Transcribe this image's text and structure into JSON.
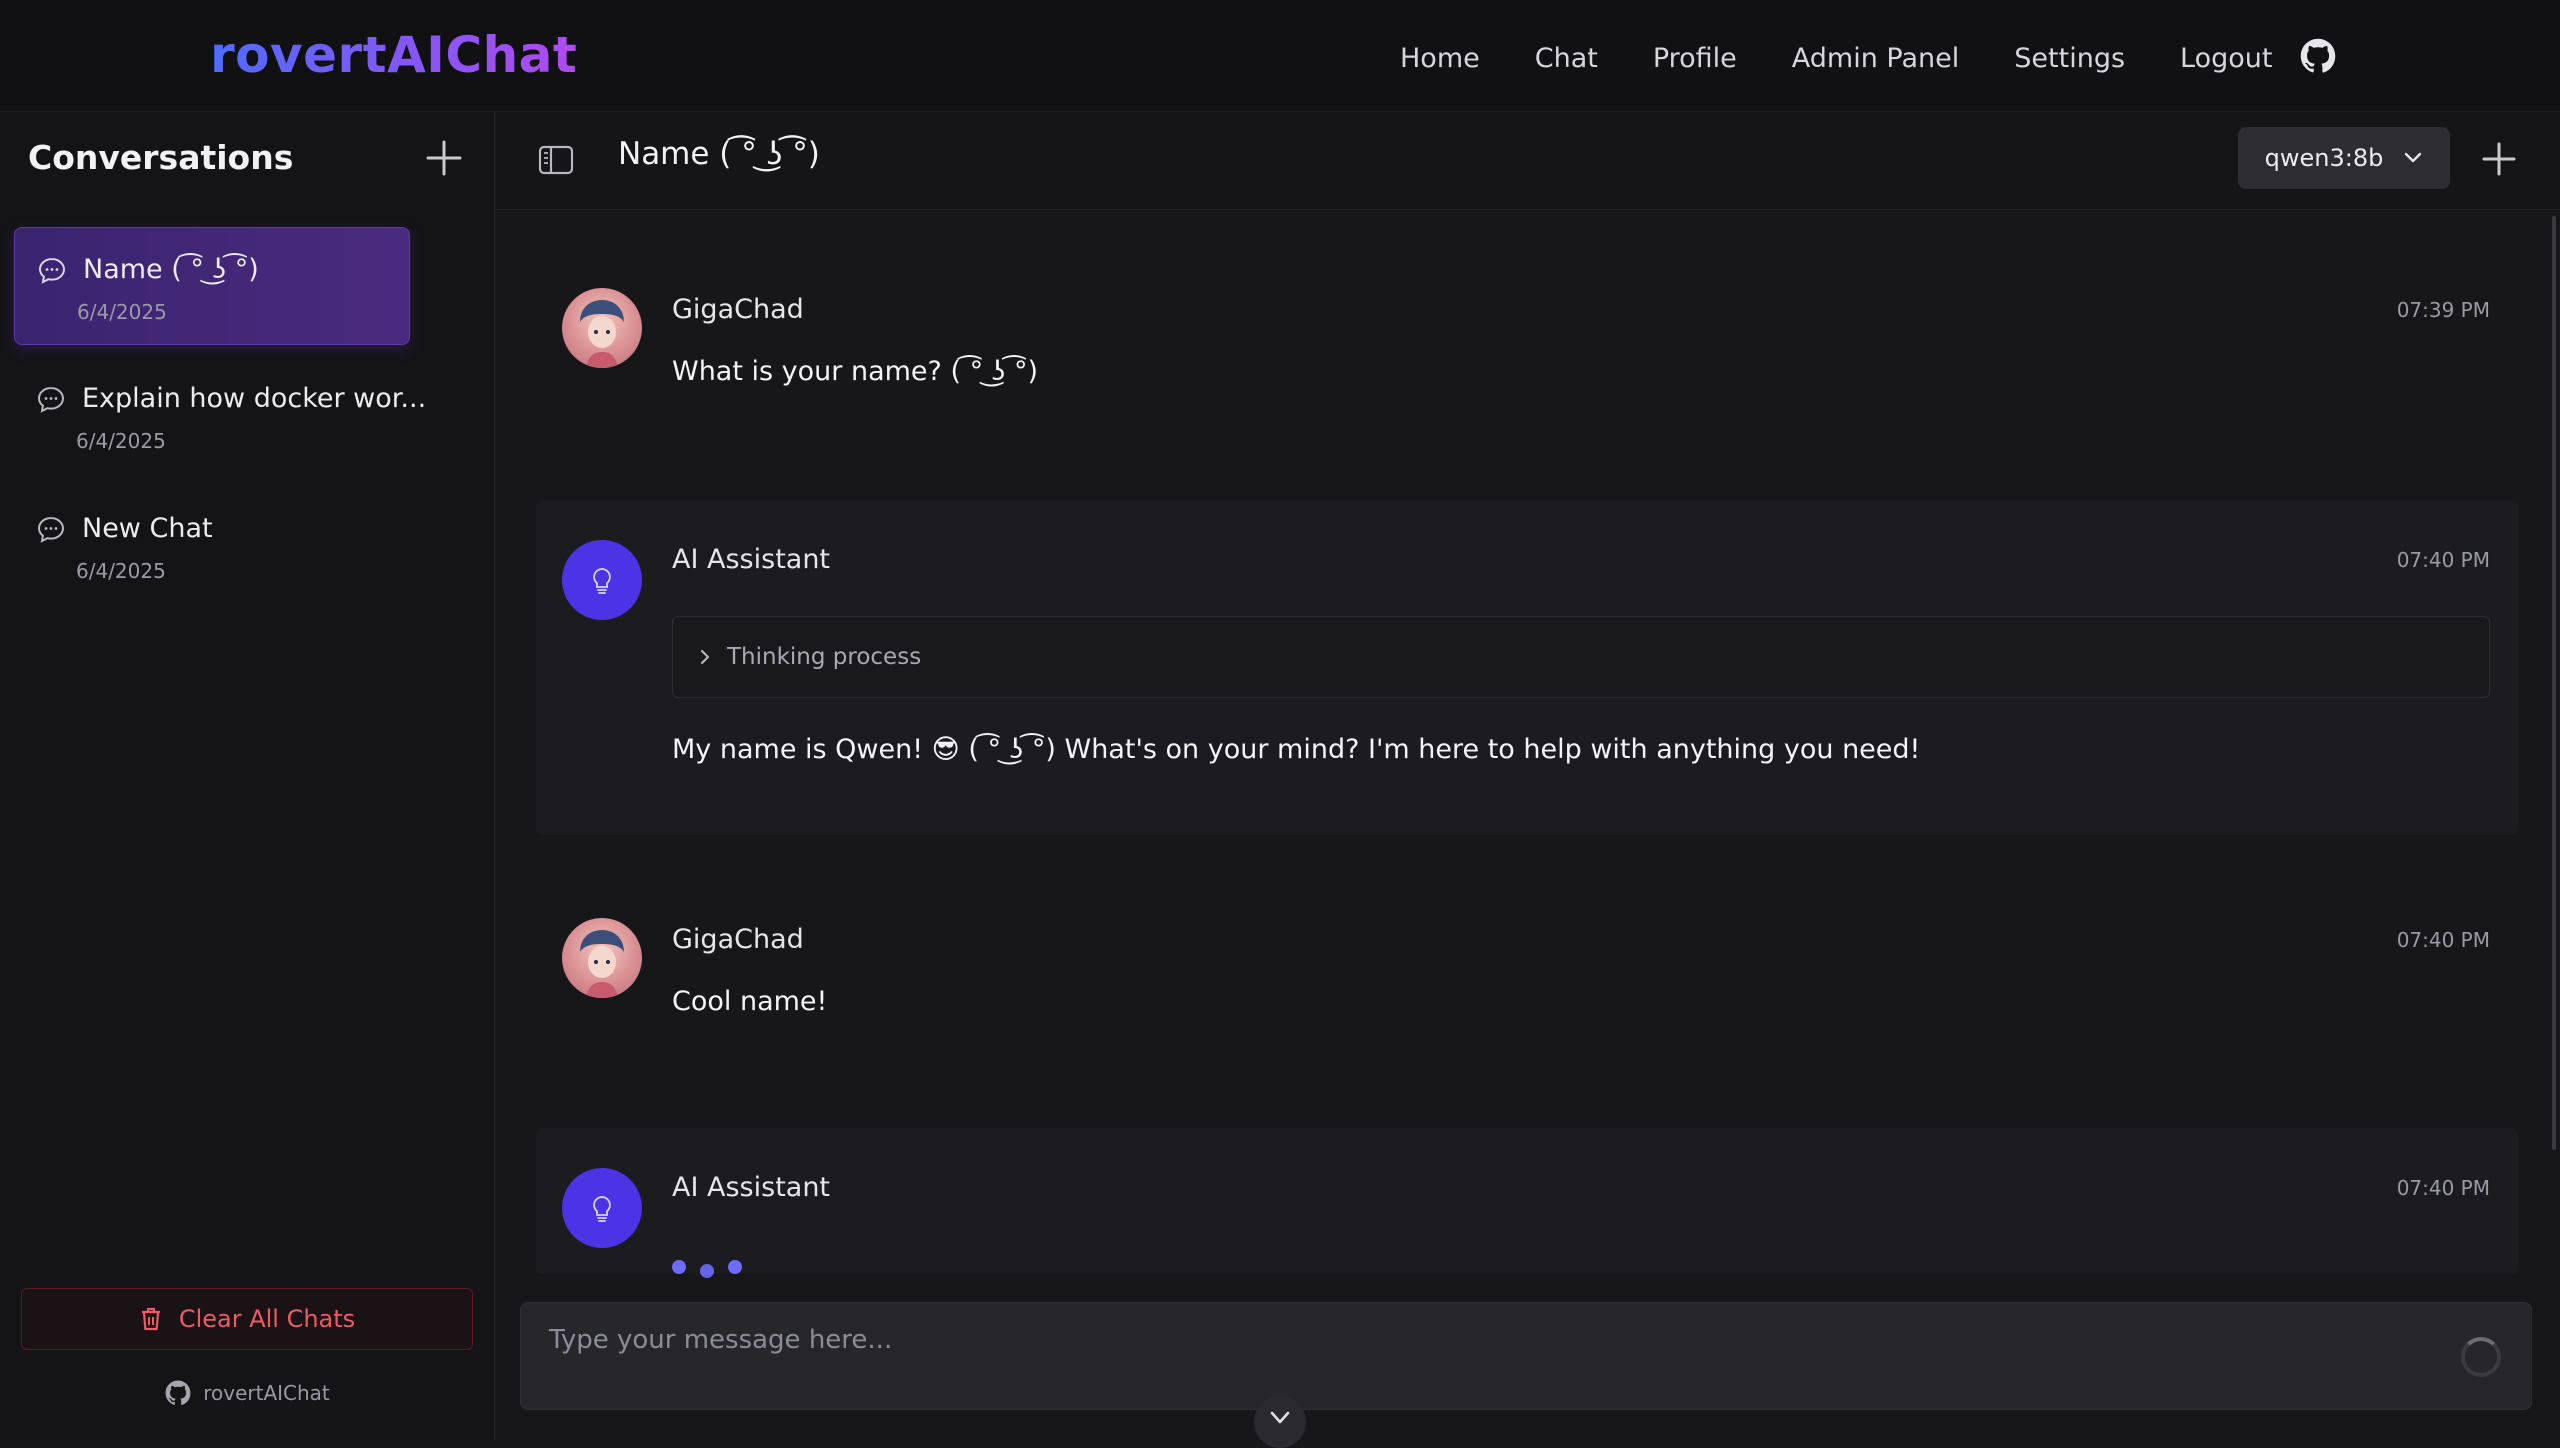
{
  "brand": "rovertAIChat",
  "nav": {
    "links": [
      "Home",
      "Chat",
      "Profile",
      "Admin Panel",
      "Settings",
      "Logout"
    ],
    "github_icon": "github-icon"
  },
  "sidebar": {
    "title": "Conversations",
    "conversations": [
      {
        "title": "Name ( ͡° ͜ʖ ͡°)",
        "date": "6/4/2025",
        "active": true
      },
      {
        "title": "Explain how docker wor...",
        "date": "6/4/2025",
        "active": false
      },
      {
        "title": "New Chat",
        "date": "6/4/2025",
        "active": false
      }
    ],
    "clear_label": "Clear All Chats",
    "footer": "rovertAIChat"
  },
  "header": {
    "chat_title": "Name ( ͡° ͜ʖ ͡°)",
    "model": "qwen3:8b"
  },
  "messages": [
    {
      "role": "user",
      "sender": "GigaChad",
      "time": "07:39 PM",
      "text": "What is your name? ( ͡° ͜ʖ ͡°)"
    },
    {
      "role": "ai",
      "sender": "AI Assistant",
      "time": "07:40 PM",
      "thinking_label": "Thinking process",
      "text": "My name is Qwen! 😎 ( ͡° ͜ʖ ͡°) What's on your mind? I'm here to help with anything you need!"
    },
    {
      "role": "user",
      "sender": "GigaChad",
      "time": "07:40 PM",
      "text": "Cool name!"
    },
    {
      "role": "ai",
      "sender": "AI Assistant",
      "time": "07:40 PM",
      "typing": true
    }
  ],
  "input": {
    "placeholder": "Type your message here..."
  },
  "colors": {
    "accent": "#4c33e6",
    "active_conv": "#3a2470",
    "danger": "#ef5a66"
  }
}
